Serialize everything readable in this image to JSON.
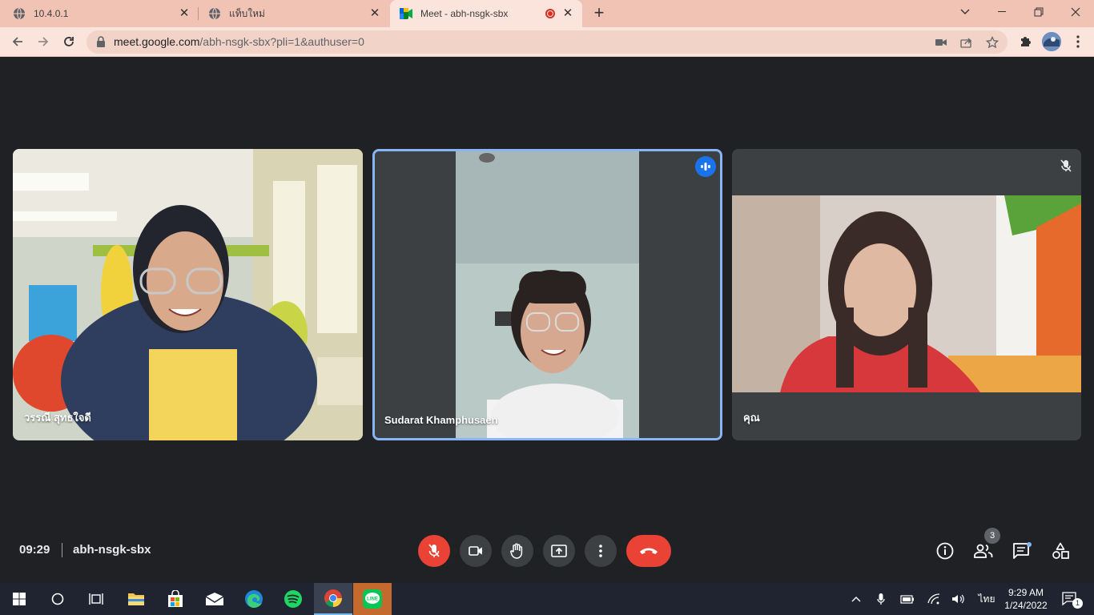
{
  "browser": {
    "tabs": [
      {
        "title": "10.4.0.1"
      },
      {
        "title": "แท็บใหม่"
      },
      {
        "title": "Meet - abh-nsgk-sbx"
      }
    ],
    "url_host": "meet.google.com",
    "url_path": "/abh-nsgk-sbx?pli=1&authuser=0"
  },
  "meet": {
    "participants": [
      {
        "name": "วรรณี สุทธใจดี"
      },
      {
        "name": "Sudarat Khamphusaen"
      },
      {
        "name": "คุณ"
      }
    ],
    "time": "09:29",
    "meeting_code": "abh-nsgk-sbx",
    "people_count": "3"
  },
  "taskbar": {
    "clock_time": "9:29 AM",
    "clock_date": "1/24/2022",
    "lang": "ไทย",
    "notifications": "1"
  },
  "colors": {
    "tab_bar": "#f0c3b4",
    "toolbar": "#fbe4dc",
    "meet_bg": "#202124",
    "tile_bg": "#3c4043",
    "speaking_border": "#8ab4f8",
    "red_button": "#ea4335",
    "speaking_badge": "#1a73e8"
  }
}
